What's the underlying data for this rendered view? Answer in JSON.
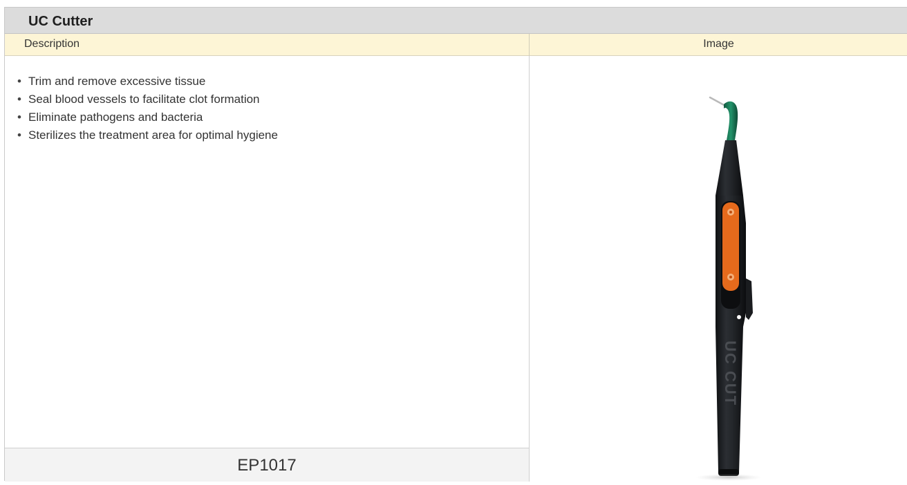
{
  "product": {
    "title": "UC Cutter",
    "columns": {
      "description": "Description",
      "image": "Image"
    },
    "features": [
      "Trim and remove excessive tissue",
      "Seal blood vessels to facilitate clot formation",
      "Eliminate pathogens and bacteria",
      "Sterilizes the treatment area for optimal hygiene"
    ],
    "code": "EP1017",
    "image": {
      "icon": "pen-handpiece-illustration",
      "engraved_text": "UC CUT",
      "colors": {
        "body": "#1d1f22",
        "tip": "#1f7a5a",
        "button_strip": "#e66a1c"
      }
    }
  }
}
